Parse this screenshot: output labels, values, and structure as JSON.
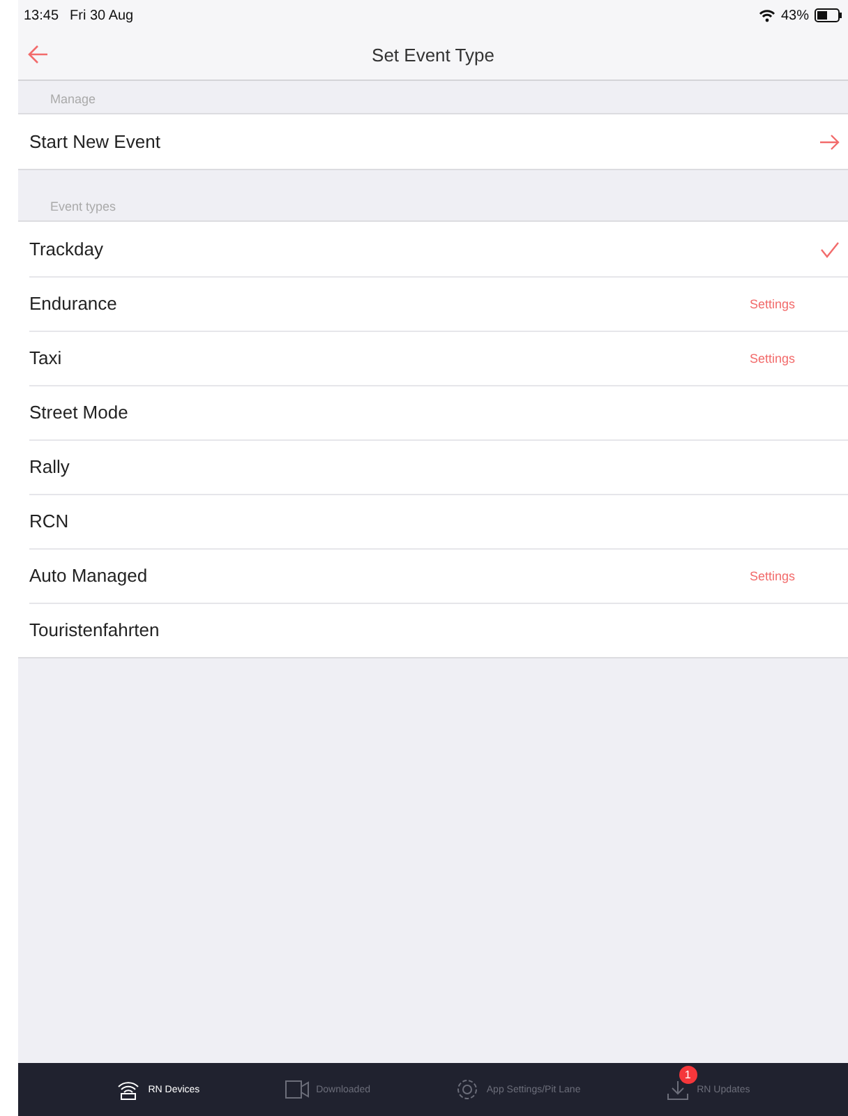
{
  "status_bar": {
    "time": "13:45",
    "date": "Fri 30 Aug",
    "battery": "43%"
  },
  "nav": {
    "title": "Set Event Type"
  },
  "sections": [
    {
      "header": "Manage",
      "rows": [
        {
          "label": "Start New Event",
          "kind": "link"
        }
      ]
    },
    {
      "header": "Event types",
      "rows": [
        {
          "label": "Trackday",
          "kind": "choice",
          "selected": true
        },
        {
          "label": "Endurance",
          "kind": "choice",
          "selected": false,
          "accessory": "Settings"
        },
        {
          "label": "Taxi",
          "kind": "choice",
          "selected": false,
          "accessory": "Settings"
        },
        {
          "label": "Street Mode",
          "kind": "choice",
          "selected": false
        },
        {
          "label": "Rally",
          "kind": "choice",
          "selected": false
        },
        {
          "label": "RCN",
          "kind": "choice",
          "selected": false
        },
        {
          "label": "Auto Managed",
          "kind": "choice",
          "selected": false,
          "accessory": "Settings"
        },
        {
          "label": "Touristenfahrten",
          "kind": "choice",
          "selected": false
        }
      ]
    }
  ],
  "tab_bar": [
    {
      "label": "RN Devices",
      "selected": true
    },
    {
      "label": "Downloaded",
      "selected": false
    },
    {
      "label": "App Settings/Pit Lane",
      "selected": false
    },
    {
      "label": "RN Updates",
      "selected": false,
      "badge": "1"
    }
  ]
}
